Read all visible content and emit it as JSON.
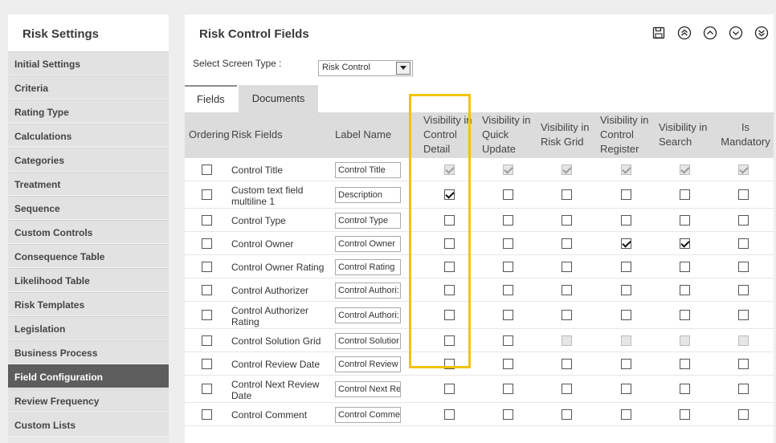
{
  "sidebar": {
    "title": "Risk Settings",
    "items": [
      {
        "label": "Initial Settings",
        "active": false
      },
      {
        "label": "Criteria",
        "active": false
      },
      {
        "label": "Rating Type",
        "active": false
      },
      {
        "label": "Calculations",
        "active": false
      },
      {
        "label": "Categories",
        "active": false
      },
      {
        "label": "Treatment",
        "active": false
      },
      {
        "label": "Sequence",
        "active": false
      },
      {
        "label": "Custom Controls",
        "active": false
      },
      {
        "label": "Consequence Table",
        "active": false
      },
      {
        "label": "Likelihood Table",
        "active": false
      },
      {
        "label": "Risk Templates",
        "active": false
      },
      {
        "label": "Legislation",
        "active": false
      },
      {
        "label": "Business Process",
        "active": false
      },
      {
        "label": "Field Configuration",
        "active": true
      },
      {
        "label": "Review Frequency",
        "active": false
      },
      {
        "label": "Custom Lists",
        "active": false
      }
    ]
  },
  "main": {
    "title": "Risk Control Fields",
    "toolbar_icons": [
      "save-icon",
      "move-top-icon",
      "move-up-icon",
      "move-down-icon",
      "move-bottom-icon"
    ],
    "screen_type": {
      "label": "Select Screen Type :",
      "value": "Risk Control"
    },
    "tabs": [
      {
        "label": "Fields",
        "active": true
      },
      {
        "label": "Documents",
        "active": false
      }
    ]
  },
  "table": {
    "headers": {
      "ordering": "Ordering",
      "risk_fields": "Risk Fields",
      "label_name": "Label Name",
      "vis_control_detail": [
        "Visibility in",
        "Control",
        "Detail"
      ],
      "vis_quick_update": [
        "Visibility in",
        "Quick",
        "Update"
      ],
      "vis_risk_grid": [
        "Visibility in",
        "Risk Grid"
      ],
      "vis_control_register": [
        "Visibility in",
        "Control",
        "Register"
      ],
      "vis_search": [
        "Visibility in",
        "Search"
      ],
      "is_mandatory": [
        "Is",
        "Mandatory"
      ]
    },
    "rows": [
      {
        "field": "Control Title",
        "label": "Control Title",
        "detail": "checked-disabled",
        "quick": "checked-disabled",
        "grid": "checked-disabled",
        "register": "checked-disabled",
        "search": "checked-disabled",
        "mandatory": "checked-disabled"
      },
      {
        "field": "Custom text field multiline 1",
        "label": "Description",
        "detail": "checked",
        "quick": "unchecked",
        "grid": "unchecked",
        "register": "unchecked",
        "search": "unchecked",
        "mandatory": "unchecked"
      },
      {
        "field": "Control Type",
        "label": "Control Type",
        "detail": "unchecked",
        "quick": "unchecked",
        "grid": "unchecked",
        "register": "unchecked",
        "search": "unchecked",
        "mandatory": "unchecked"
      },
      {
        "field": "Control Owner",
        "label": "Control Owner",
        "detail": "unchecked",
        "quick": "unchecked",
        "grid": "unchecked",
        "register": "checked",
        "search": "checked",
        "mandatory": "unchecked"
      },
      {
        "field": "Control Owner Rating",
        "label": "Control Rating",
        "detail": "unchecked",
        "quick": "unchecked",
        "grid": "unchecked",
        "register": "unchecked",
        "search": "unchecked",
        "mandatory": "unchecked"
      },
      {
        "field": "Control Authorizer",
        "label": "Control Authori:",
        "detail": "unchecked",
        "quick": "unchecked",
        "grid": "unchecked",
        "register": "unchecked",
        "search": "unchecked",
        "mandatory": "unchecked"
      },
      {
        "field": "Control Authorizer Rating",
        "label": "Control Authori:",
        "detail": "unchecked",
        "quick": "unchecked",
        "grid": "unchecked",
        "register": "unchecked",
        "search": "unchecked",
        "mandatory": "unchecked"
      },
      {
        "field": "Control Solution Grid",
        "label": "Control Solutior",
        "detail": "unchecked",
        "quick": "unchecked",
        "grid": "disabled",
        "register": "disabled",
        "search": "disabled",
        "mandatory": "disabled"
      },
      {
        "field": "Control Review Date",
        "label": "Control Review",
        "detail": "unchecked",
        "quick": "unchecked",
        "grid": "unchecked",
        "register": "unchecked",
        "search": "unchecked",
        "mandatory": "unchecked"
      },
      {
        "field": "Control Next Review Date",
        "label": "Control Next Re",
        "detail": "unchecked",
        "quick": "unchecked",
        "grid": "unchecked",
        "register": "unchecked",
        "search": "unchecked",
        "mandatory": "unchecked"
      },
      {
        "field": "Control Comment",
        "label": "Control Comme",
        "detail": "unchecked",
        "quick": "unchecked",
        "grid": "unchecked",
        "register": "unchecked",
        "search": "unchecked",
        "mandatory": "unchecked"
      }
    ]
  },
  "colors": {
    "highlight": "#f4c20d",
    "active_nav": "#5d5d5d",
    "header_bg": "#dcdcdc"
  }
}
